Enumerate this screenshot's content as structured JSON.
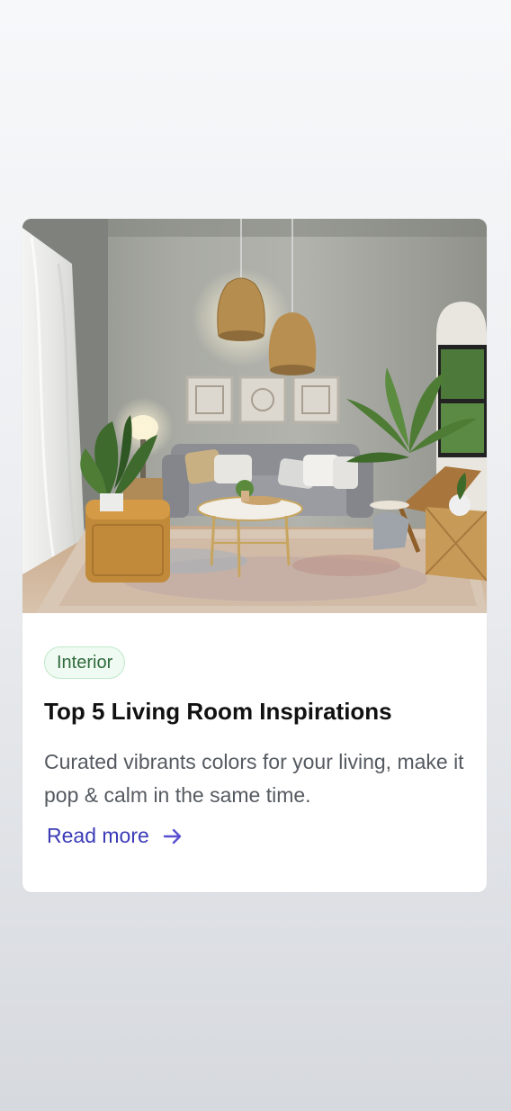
{
  "card": {
    "image_alt": "Living room interior with grey sofa, rattan pendant lamps, plants and patterned rug",
    "badge": "Interior",
    "title": "Top 5 Living Room Inspirations",
    "description": "Curated vibrants colors for your living, make it pop & calm in the same time.",
    "read_more_label": "Read more",
    "read_more_icon": "arrow-right-icon"
  },
  "colors": {
    "accent": "#3b3bb8",
    "badge_text": "#2f6b3c",
    "badge_bg": "#effaf2",
    "badge_border": "#bfe8c9"
  }
}
